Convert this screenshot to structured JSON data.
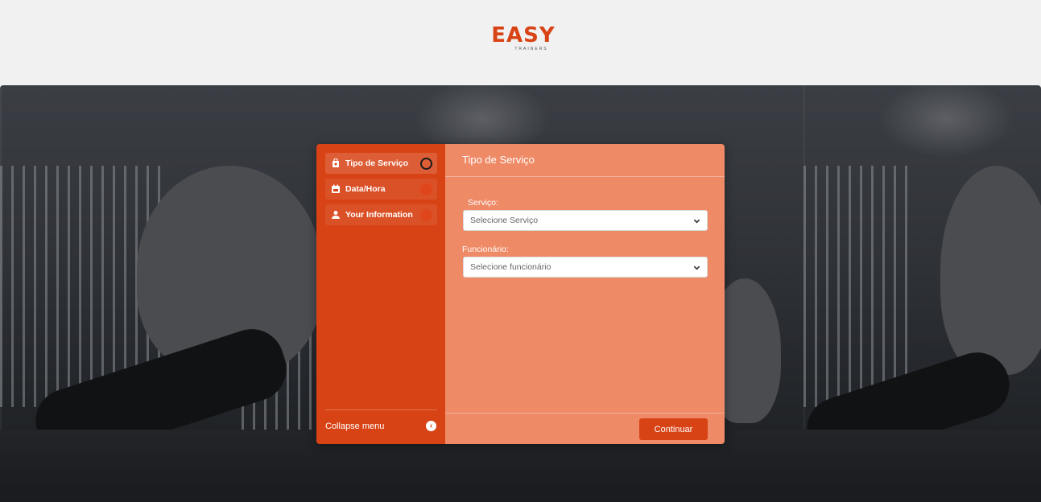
{
  "brand": {
    "name": "EASY",
    "tagline": "TRAINERS",
    "accent_color": "#d84315",
    "panel_color": "#ef8a66"
  },
  "sidebar": {
    "items": [
      {
        "label": "Tipo de Serviço",
        "icon": "shopping-bag-icon",
        "state": "current"
      },
      {
        "label": "Data/Hora",
        "icon": "calendar-icon",
        "state": "pending"
      },
      {
        "label": "Your Information",
        "icon": "user-icon",
        "state": "pending"
      }
    ],
    "collapse_label": "Collapse menu",
    "collapse_icon": "chevron-left-circle-icon"
  },
  "panel": {
    "title": "Tipo de Serviço",
    "service": {
      "label": "Serviço:",
      "placeholder": "Selecione Serviço"
    },
    "employee": {
      "label": "Funcionário:",
      "placeholder": "Selecione funcionário"
    },
    "continue_label": "Continuar"
  }
}
